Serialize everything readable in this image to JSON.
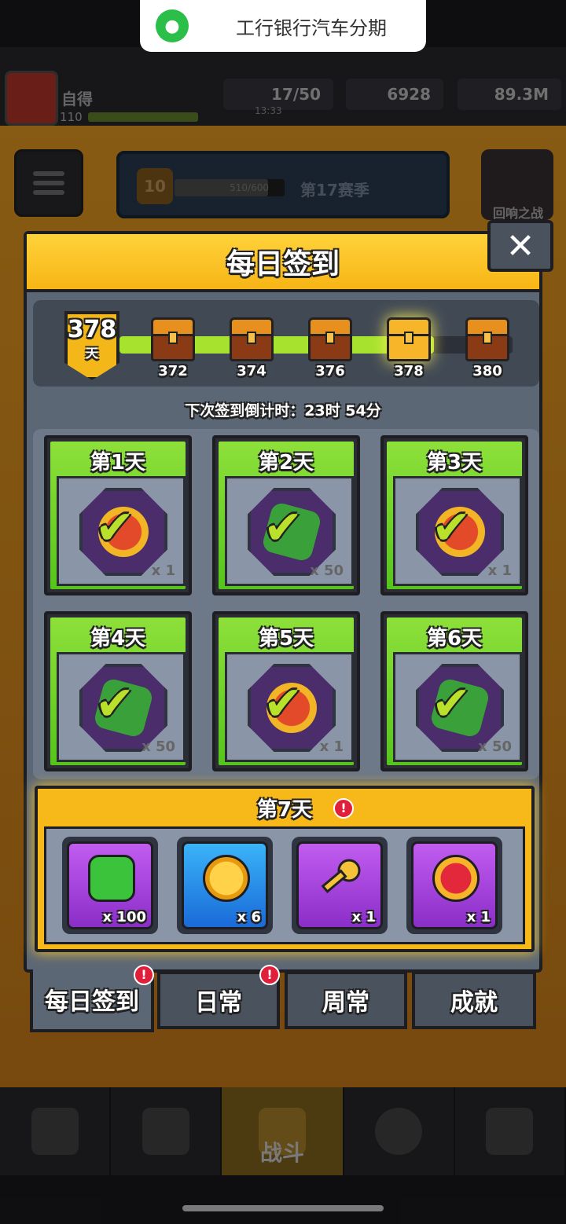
{
  "notification": {
    "app_icon": "wechat-icon",
    "text": "工行银行汽车分期"
  },
  "hud": {
    "player_name": "自得",
    "player_level": "110",
    "energy": "17/50",
    "energy_timer": "13:33",
    "gems": "6928",
    "coins": "89.3M"
  },
  "season": {
    "level": "10",
    "progress": "510/600",
    "progress_fraction": 0.85,
    "name": "第17赛季"
  },
  "echo_battle": {
    "label": "回响之战"
  },
  "modal": {
    "title": "每日签到",
    "close_label": "✕",
    "streak": {
      "days": "378",
      "unit": "天"
    },
    "progress_fraction": 0.8,
    "milestones": [
      {
        "day": "372",
        "state": "claimed"
      },
      {
        "day": "374",
        "state": "claimed"
      },
      {
        "day": "376",
        "state": "claimed"
      },
      {
        "day": "378",
        "state": "ready"
      },
      {
        "day": "380",
        "state": "locked"
      }
    ],
    "countdown": "下次签到倒计时：23时 54分",
    "days": [
      {
        "title": "第1天",
        "item": "coin",
        "qty": "x 1",
        "claimed": true
      },
      {
        "title": "第2天",
        "item": "gem",
        "qty": "x 50",
        "claimed": true
      },
      {
        "title": "第3天",
        "item": "coin",
        "qty": "x 1",
        "claimed": true
      },
      {
        "title": "第4天",
        "item": "gem",
        "qty": "x 50",
        "claimed": true
      },
      {
        "title": "第5天",
        "item": "coin",
        "qty": "x 1",
        "claimed": true
      },
      {
        "title": "第6天",
        "item": "gem",
        "qty": "x 50",
        "claimed": true
      }
    ],
    "day7": {
      "title": "第7天",
      "alert": "!",
      "rewards": [
        {
          "item": "gem-icon",
          "qty": "x 100",
          "bg": "purple"
        },
        {
          "item": "coin-speed-icon",
          "qty": "x 6",
          "bg": "blue"
        },
        {
          "item": "key-icon",
          "qty": "x 1",
          "bg": "purple"
        },
        {
          "item": "heart-icon",
          "qty": "x 1",
          "bg": "purple"
        }
      ]
    }
  },
  "tabs": [
    {
      "label": "每日签到",
      "active": true,
      "badge": "!"
    },
    {
      "label": "日常",
      "active": false,
      "badge": "!"
    },
    {
      "label": "周常",
      "active": false
    },
    {
      "label": "成就",
      "active": false
    }
  ],
  "bottom_nav": {
    "battle_label": "战斗"
  },
  "colors": {
    "accent_yellow": "#f7b516",
    "claimed_green": "#8ee03a",
    "alert_red": "#e0203a"
  }
}
